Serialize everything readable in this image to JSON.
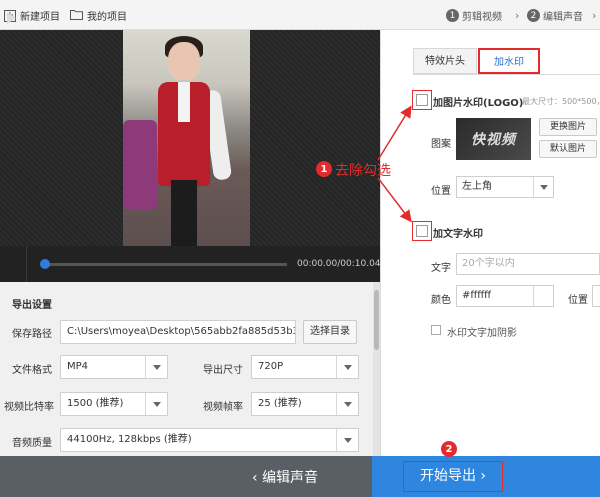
{
  "toolbar": {
    "new_project": "新建项目",
    "my_projects": "我的项目",
    "new_project_icon": "plus-icon",
    "my_projects_icon": "folder-icon"
  },
  "steps": [
    {
      "num": "1",
      "label": "剪辑视频"
    },
    {
      "num": "2",
      "label": "编辑声音"
    }
  ],
  "player": {
    "time": "00:00.00/00:10.04",
    "progress": 0.0
  },
  "export": {
    "title": "导出设置",
    "save_path_label": "保存路径",
    "save_path_value": "C:\\Users\\moyea\\Desktop\\565abb2fa885d53b3d09",
    "browse_button": "选择目录",
    "format_label": "文件格式",
    "format_value": "MP4",
    "size_label": "导出尺寸",
    "size_value": "720P",
    "video_bitrate_label": "视频比特率",
    "video_bitrate_value": "1500 (推荐)",
    "framerate_label": "视频帧率",
    "framerate_value": "25 (推荐)",
    "audio_label": "音频质量",
    "audio_value": "44100Hz, 128kbps (推荐)"
  },
  "panel": {
    "tab_intro": "特效片头",
    "tab_watermark": "加水印",
    "image_wm_label": "加图片水印(LOGO)",
    "image_wm_hint": "最大尺寸：500*500，",
    "pattern_label": "图案",
    "logo_text": "快视频",
    "change_image": "更换图片",
    "default_image": "默认图片",
    "position_label": "位置",
    "position_value": "左上角",
    "text_wm_label": "加文字水印",
    "text_label": "文字",
    "text_placeholder": "20个字以内",
    "color_label": "颜色",
    "color_value": "#ffffff",
    "text_position_label": "位置",
    "shadow_label": "水印文字加阴影"
  },
  "annotations": {
    "badge1": "1",
    "badge1_text": "去除勾选",
    "badge2": "2"
  },
  "bottom": {
    "edit_sound": "编辑声音",
    "start_export": "开始导出"
  },
  "colors": {
    "accent_blue": "#2f86de",
    "annotation_red": "#e22b2b",
    "link_blue": "#2b6fd6"
  }
}
